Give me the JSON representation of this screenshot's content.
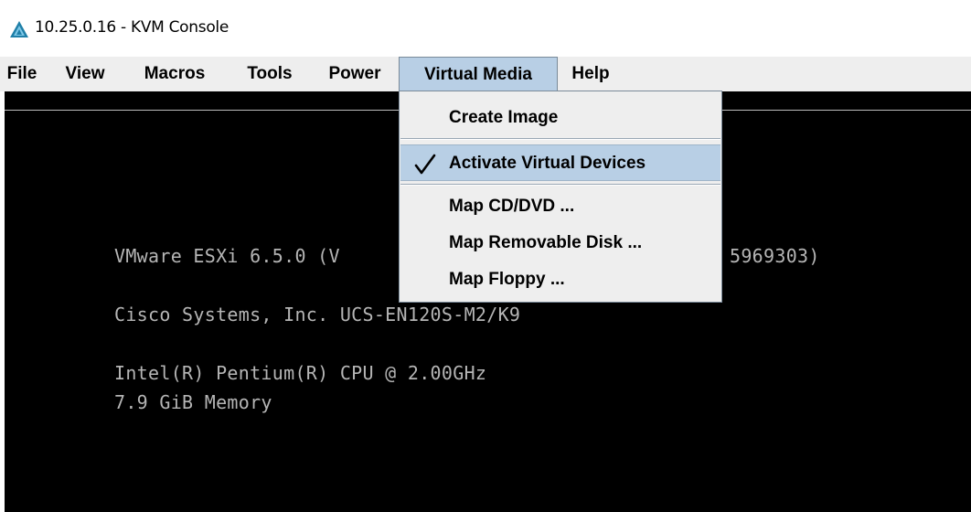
{
  "window": {
    "title": "10.25.0.16 - KVM Console",
    "icon": "kvm-triangle-icon",
    "icon_color": "#1f7fa8"
  },
  "menubar": {
    "items": [
      {
        "label": "File"
      },
      {
        "label": "View"
      },
      {
        "label": "Macros"
      },
      {
        "label": "Tools"
      },
      {
        "label": "Power"
      },
      {
        "label": "Virtual Media",
        "active": true
      },
      {
        "label": "Help"
      }
    ]
  },
  "virtual_media_menu": {
    "items": [
      {
        "label": "Create Image",
        "checked": false
      },
      {
        "label": "Activate Virtual Devices",
        "checked": true
      },
      {
        "label": "Map CD/DVD ...",
        "checked": false
      },
      {
        "label": "Map Removable Disk ...",
        "checked": false
      },
      {
        "label": "Map Floppy ...",
        "checked": false
      }
    ]
  },
  "console": {
    "line1_left": "VMware ESXi 6.5.0 (V",
    "line1_right": "5969303)",
    "line2": "Cisco Systems, Inc. UCS-EN120S-M2/K9",
    "line3": "Intel(R) Pentium(R) CPU @ 2.00GHz",
    "line4": "7.9 GiB Memory"
  },
  "colors": {
    "menu_highlight": "#b8cfe5",
    "console_background": "#000000",
    "console_text": "#b5b5b5"
  }
}
